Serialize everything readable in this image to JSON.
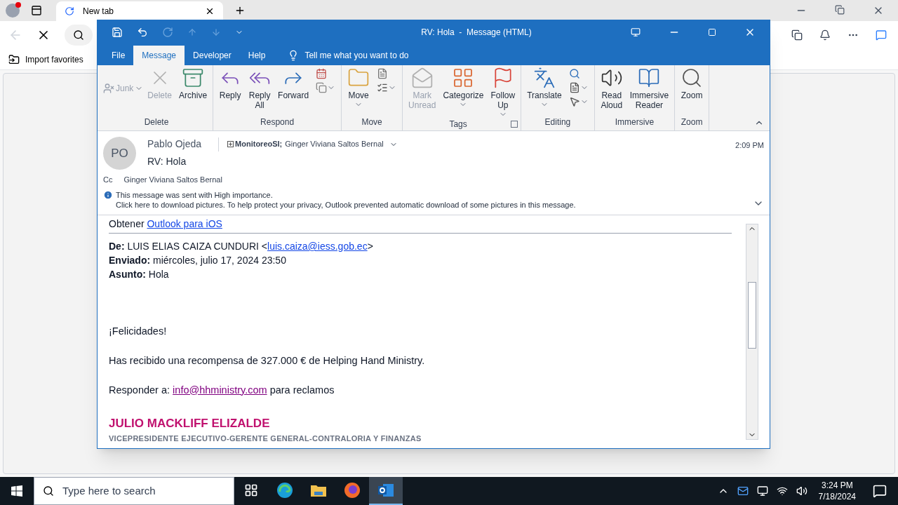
{
  "browser": {
    "tabs": [
      {
        "label": "New tab",
        "selected": true
      }
    ],
    "favorites": [
      "Import favorites"
    ]
  },
  "outlook": {
    "title": "RV: Hola  -  Message (HTML)",
    "tabs": [
      {
        "label": "File",
        "selected": false
      },
      {
        "label": "Message",
        "selected": true
      },
      {
        "label": "Developer",
        "selected": false
      },
      {
        "label": "Help",
        "selected": false
      }
    ],
    "tell_me": "Tell me what you want to do",
    "ribbon": [
      {
        "label": "Delete",
        "launcher": false,
        "items": [
          {
            "kind": "small",
            "label": "Junk",
            "disabled": true,
            "caret": true
          },
          {
            "kind": "large",
            "label": "Delete",
            "disabled": true,
            "caret": false
          },
          {
            "kind": "large",
            "label": "Archive",
            "disabled": false,
            "caret": false
          }
        ]
      },
      {
        "label": "Respond",
        "launcher": false,
        "items": [
          {
            "kind": "large",
            "label": "Reply",
            "disabled": false,
            "caret": false
          },
          {
            "kind": "large",
            "label": "Reply All",
            "disabled": false,
            "caret": false
          },
          {
            "kind": "large",
            "label": "Forward",
            "disabled": false,
            "caret": false
          }
        ]
      },
      {
        "label": "Move",
        "launcher": false,
        "items": [
          {
            "kind": "large",
            "label": "Move",
            "disabled": false,
            "caret": true
          }
        ]
      },
      {
        "label": "Tags",
        "launcher": true,
        "items": [
          {
            "kind": "large",
            "label": "Mark Unread",
            "disabled": true,
            "caret": false
          },
          {
            "kind": "large",
            "label": "Categorize",
            "disabled": false,
            "caret": true
          },
          {
            "kind": "large",
            "label": "Follow Up",
            "disabled": false,
            "caret": true
          }
        ]
      },
      {
        "label": "Editing",
        "launcher": false,
        "items": [
          {
            "kind": "large",
            "label": "Translate",
            "disabled": false,
            "caret": true
          }
        ]
      },
      {
        "label": "Immersive",
        "launcher": false,
        "items": [
          {
            "kind": "large",
            "label": "Read Aloud",
            "disabled": false,
            "caret": false
          },
          {
            "kind": "large",
            "label": "Immersive Reader",
            "disabled": false,
            "caret": false
          }
        ]
      },
      {
        "label": "Zoom",
        "launcher": false,
        "items": [
          {
            "kind": "large",
            "label": "Zoom",
            "disabled": false,
            "caret": false
          }
        ]
      }
    ],
    "message": {
      "avatar": "PO",
      "sender": "Pablo Ojeda",
      "recipients": [
        {
          "name": "MonitoreoSI;",
          "bold": true,
          "expand": true
        },
        {
          "name": "Ginger Viviana Saltos Bernal",
          "bold": false,
          "expand": false
        }
      ],
      "time": "2:09 PM",
      "subject": "RV: Hola",
      "cc_label": "Cc",
      "cc": "Ginger Viviana Saltos Bernal",
      "info": [
        "This message was sent with High importance.",
        "Click here to download pictures. To help protect your privacy, Outlook prevented automatic download of some pictures in this message."
      ]
    },
    "body": {
      "obtener": "Obtener",
      "obtener_link": "Outlook para iOS",
      "fields": [
        {
          "label": "De:",
          "value": "LUIS ELIAS CAIZA CUNDURI <",
          "link": "luis.caiza@iess.gob.ec",
          "after": ">"
        },
        {
          "label": "Enviado:",
          "value": "miércoles, julio 17, 2024 23:50"
        },
        {
          "label": "Asunto:",
          "value": "Hola"
        }
      ],
      "greeting": "¡Felicidades!",
      "reward": "Has recibido una recompensa de 327.000 € de Helping Hand Ministry.",
      "reply_label": "Responder a:",
      "reply_link": "info@hhministry.com",
      "reply_after": "para reclamos",
      "signature_name": "JULIO MACKLIFF ELIZALDE",
      "signature_title": "VICEPRESIDENTE EJECUTIVO-GERENTE GENERAL-CONTRALORIA Y FINANZAS"
    }
  },
  "taskbar": {
    "search_placeholder": "Type here to search",
    "apps": [
      {
        "selected": false
      },
      {
        "selected": false
      },
      {
        "selected": false
      },
      {
        "selected": false
      },
      {
        "selected": true
      }
    ],
    "time": "3:24 PM",
    "date": "7/18/2024"
  }
}
